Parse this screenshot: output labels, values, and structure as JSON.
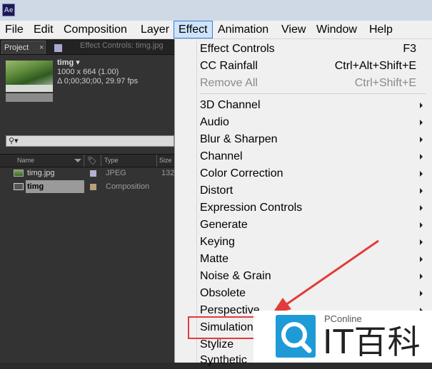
{
  "app": {
    "icon_label": "Ae"
  },
  "menubar": {
    "items": [
      {
        "label": "File"
      },
      {
        "label": "Edit"
      },
      {
        "label": "Composition"
      },
      {
        "label": "Layer"
      },
      {
        "label": "Effect"
      },
      {
        "label": "Animation"
      },
      {
        "label": "View"
      },
      {
        "label": "Window"
      },
      {
        "label": "Help"
      }
    ]
  },
  "panel": {
    "tabs": {
      "project": "Project",
      "close": "×",
      "effect_controls": "Effect Controls: timg.jpg"
    },
    "composition": {
      "name": "timg ▾",
      "resolution": "1000 x 664 (1.00)",
      "duration": "Δ 0;00;30;00, 29.97 fps"
    },
    "search_glyph": "⚲▾",
    "columns": {
      "name": "Name",
      "type": "Type",
      "size": "Size"
    },
    "rows": [
      {
        "name": "timg.jpg",
        "type": "JPEG",
        "size": "132",
        "swatch": "#b6b0d6"
      },
      {
        "name": "timg",
        "type": "Composition",
        "size": "",
        "swatch": "#b8a07a"
      }
    ]
  },
  "effect_menu": {
    "top_items": [
      {
        "label": "Effect Controls",
        "shortcut": "F3"
      },
      {
        "label": "CC Rainfall",
        "shortcut": "Ctrl+Alt+Shift+E"
      },
      {
        "label": "Remove All",
        "shortcut": "Ctrl+Shift+E",
        "disabled": true
      }
    ],
    "submenu_items": [
      "3D Channel",
      "Audio",
      "Blur & Sharpen",
      "Channel",
      "Color Correction",
      "Distort",
      "Expression Controls",
      "Generate",
      "Keying",
      "Matte",
      "Noise & Grain",
      "Obsolete",
      "Perspective",
      "Simulation",
      "Stylize",
      "Synthetic"
    ],
    "highlighted_item": "Simulation"
  },
  "watermark": {
    "brand": "PConline",
    "text": "IT百科"
  },
  "colors": {
    "accent": "#3d7bd6",
    "highlight_box": "#e23b3b",
    "arrow": "#e23b3b",
    "logo": "#1e9bd7"
  }
}
